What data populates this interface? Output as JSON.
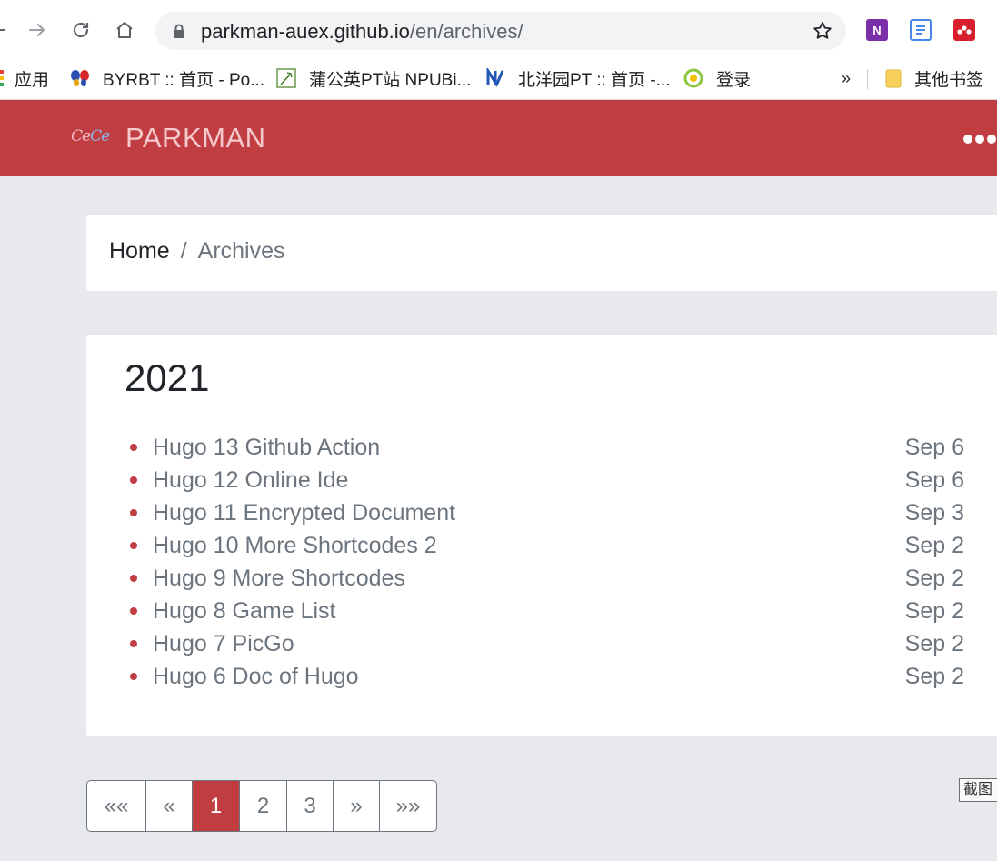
{
  "browser": {
    "url_host": "parkman-auex.github.io",
    "url_path": "/en/archives/",
    "bookmarks": [
      {
        "label": "应用",
        "icon": "apps-grid-icon"
      },
      {
        "label": "BYRBT :: 首页 - Po...",
        "icon": "butterfly-icon"
      },
      {
        "label": "蒲公英PT站 NPUBi...",
        "icon": "dandelion-icon"
      },
      {
        "label": "北洋园PT :: 首页 -...",
        "icon": "n-logo-icon"
      },
      {
        "label": "登录",
        "icon": "green-swirl-icon"
      }
    ],
    "overflow_label": "»",
    "other_bookmarks_label": "其他书签",
    "extensions": [
      "onenote-icon",
      "docs-icon",
      "mendeley-icon"
    ]
  },
  "site": {
    "logo_text_1": "Ce",
    "logo_text_2": "Ce",
    "brand": "PARKMAN",
    "accent": "#c03e41"
  },
  "breadcrumb": {
    "home": "Home",
    "separator": "/",
    "current": "Archives"
  },
  "archive": {
    "year": "2021",
    "posts": [
      {
        "title": "Hugo 13 Github Action",
        "date": "Sep 6"
      },
      {
        "title": "Hugo 12 Online Ide",
        "date": "Sep 6"
      },
      {
        "title": "Hugo 11 Encrypted Document",
        "date": "Sep 3"
      },
      {
        "title": "Hugo 10 More Shortcodes 2",
        "date": "Sep 2"
      },
      {
        "title": "Hugo 9 More Shortcodes",
        "date": "Sep 2"
      },
      {
        "title": "Hugo 8 Game List",
        "date": "Sep 2"
      },
      {
        "title": "Hugo 7 PicGo",
        "date": "Sep 2"
      },
      {
        "title": "Hugo 6 Doc of Hugo",
        "date": "Sep 2"
      }
    ]
  },
  "pagination": {
    "first": "««",
    "prev": "«",
    "pages": [
      "1",
      "2",
      "3"
    ],
    "current_page": "1",
    "next": "»",
    "last": "»»"
  },
  "screenshot_tag": "截图"
}
